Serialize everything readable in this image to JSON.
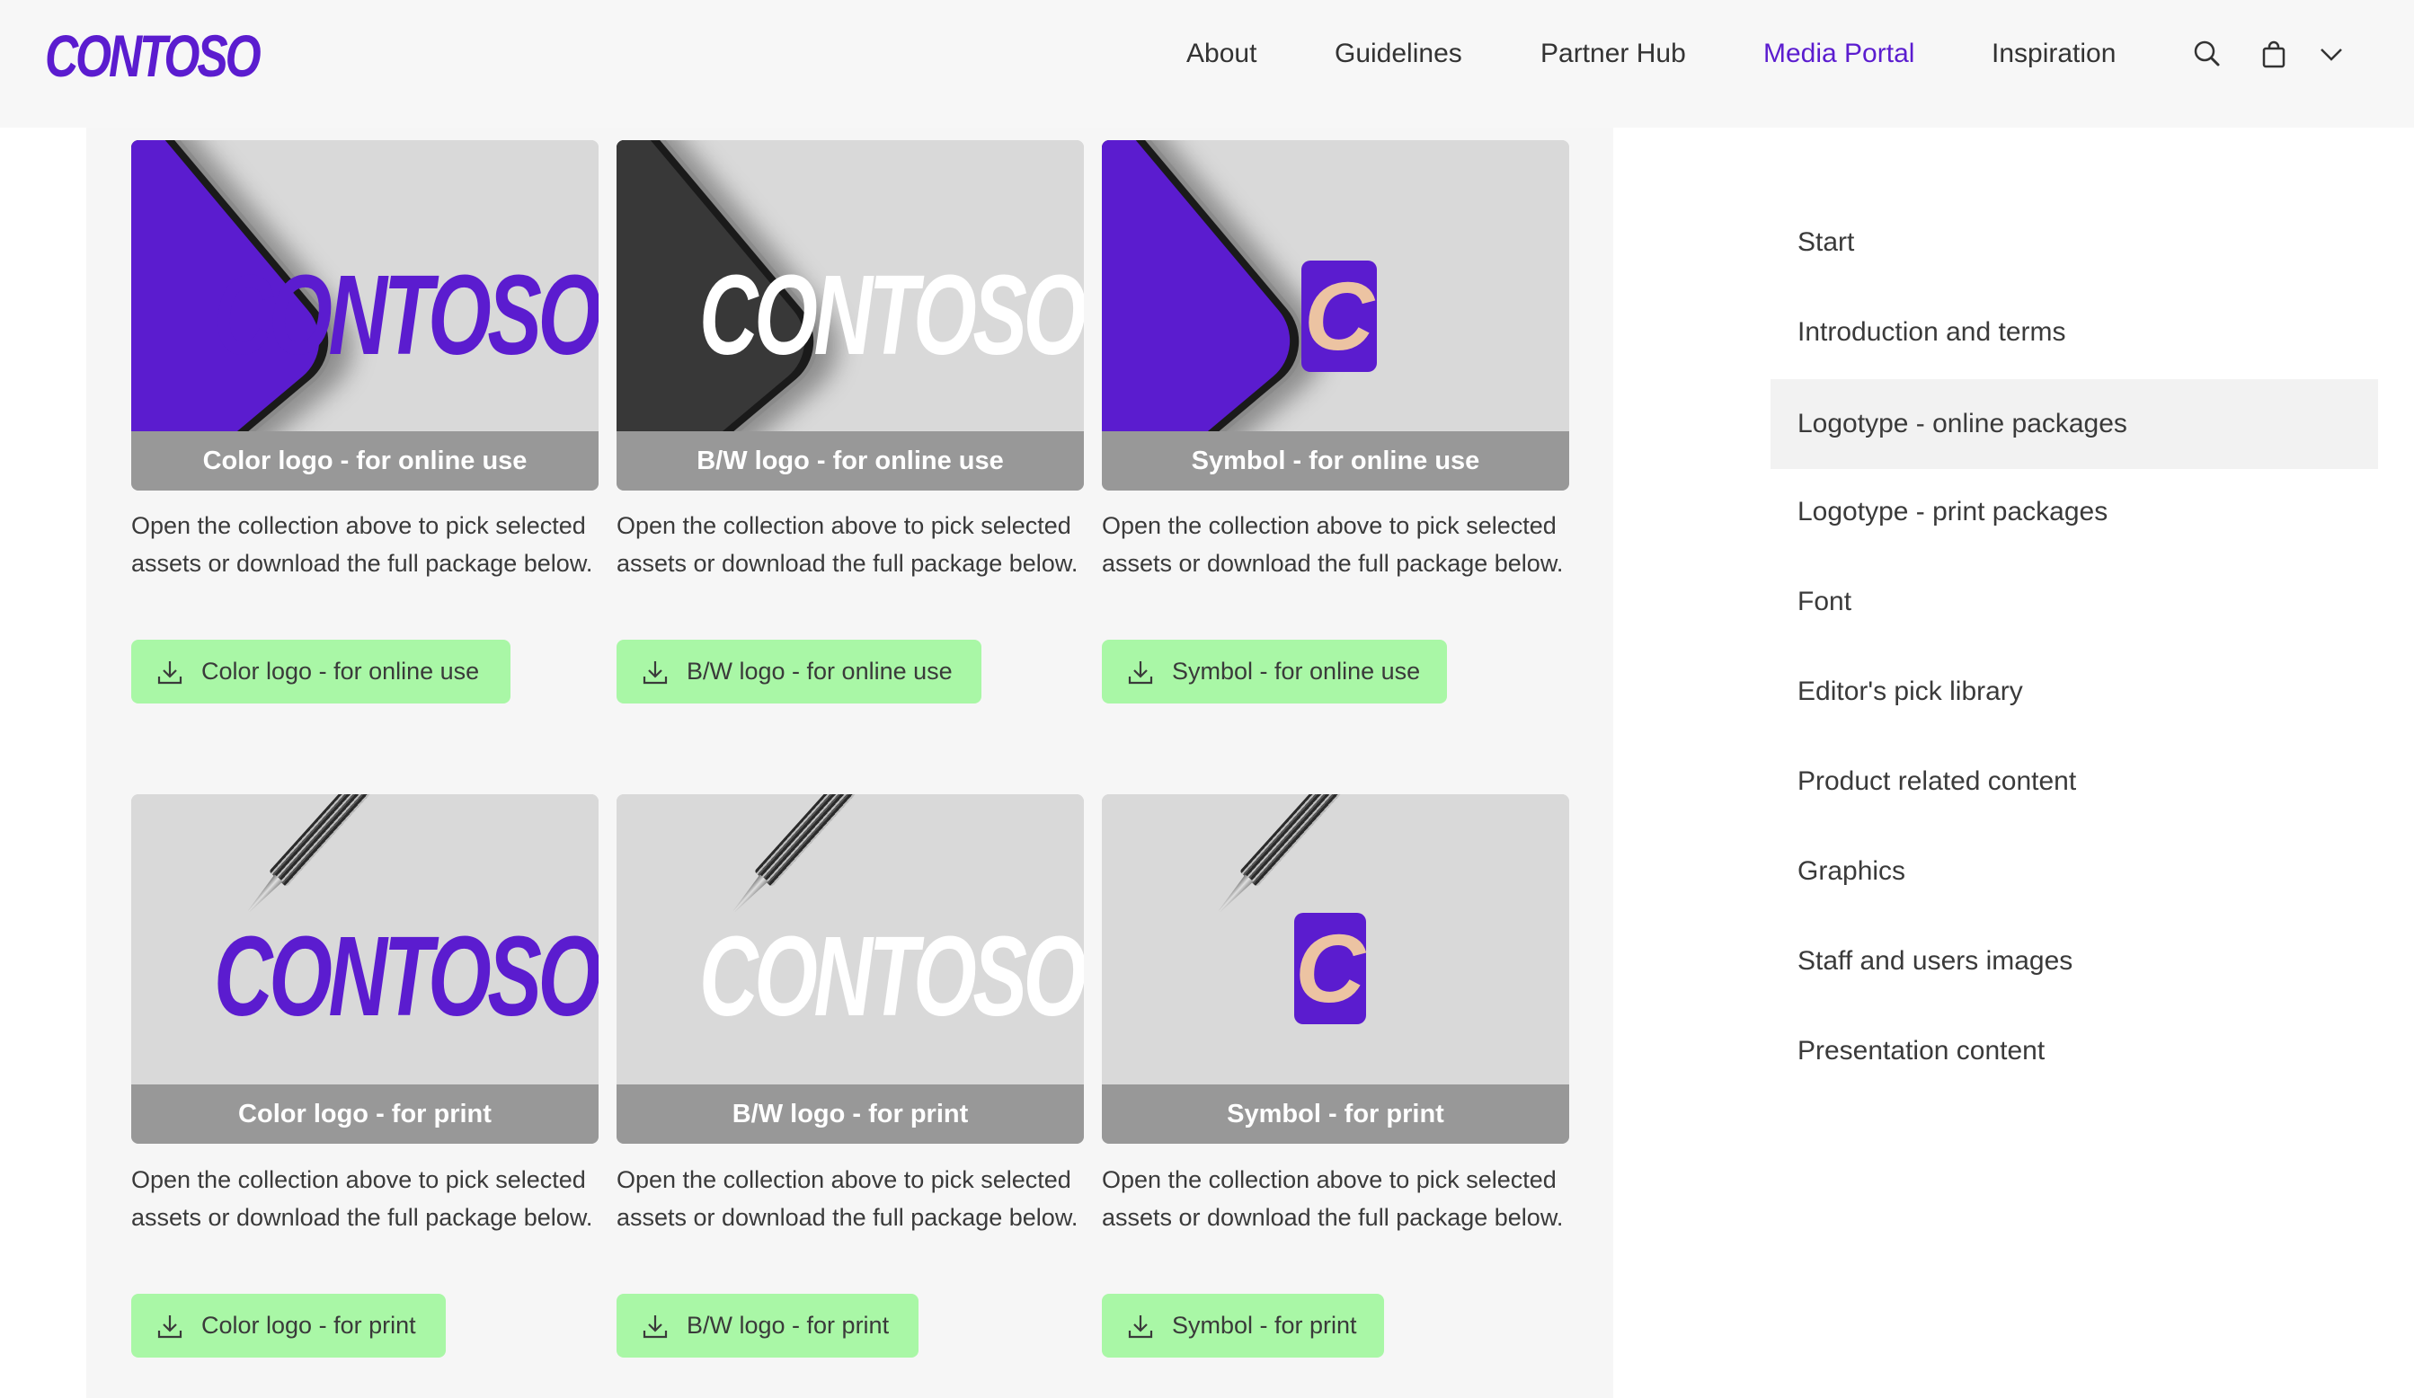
{
  "header": {
    "brand": "CONTOSO",
    "nav": [
      {
        "label": "About",
        "active": false
      },
      {
        "label": "Guidelines",
        "active": false
      },
      {
        "label": "Partner Hub",
        "active": false
      },
      {
        "label": "Media Portal",
        "active": true
      },
      {
        "label": "Inspiration",
        "active": false
      }
    ],
    "icons": [
      "search-icon",
      "shopping-bag-icon",
      "chevron-down-icon"
    ]
  },
  "colors": {
    "brand_purple": "#5b1ccf",
    "button_green": "#a9f7a6",
    "caption_gray": "#989898",
    "symbol_peach": "#ecc3a2"
  },
  "cards": [
    {
      "title": "Color logo - for online use",
      "description": "Open the collection above to pick selected assets or download the full package below.",
      "button": "Color logo - for online use",
      "image": {
        "prop": "phone",
        "phone_screen": "purple",
        "logo": "wordmark",
        "logo_style": "color",
        "wordmark": "CONTOSO"
      }
    },
    {
      "title": "B/W logo - for online use",
      "description": "Open the collection above to pick selected assets or download the full package below.",
      "button": "B/W logo - for online use",
      "image": {
        "prop": "phone",
        "phone_screen": "dark",
        "logo": "wordmark",
        "logo_style": "bw",
        "wordmark": "CONTOSO"
      }
    },
    {
      "title": "Symbol - for online use",
      "description": "Open the collection above to pick selected assets or download the full package below.",
      "button": "Symbol - for online use",
      "image": {
        "prop": "phone",
        "phone_screen": "purple",
        "logo": "symbol",
        "symbol": "C"
      }
    },
    {
      "title": "Color logo - for print",
      "description": "Open the collection above to pick selected assets or download the full package below.",
      "button": "Color logo - for print",
      "image": {
        "prop": "pen",
        "logo": "wordmark",
        "logo_style": "color",
        "wordmark": "CONTOSO"
      }
    },
    {
      "title": "B/W logo - for print",
      "description": "Open the collection above to pick selected assets or download the full package below.",
      "button": "B/W logo - for print",
      "image": {
        "prop": "pen",
        "logo": "wordmark",
        "logo_style": "bw",
        "wordmark": "CONTOSO"
      }
    },
    {
      "title": "Symbol - for print",
      "description": "Open the collection above to pick selected assets or download the full package below.",
      "button": "Symbol - for print",
      "image": {
        "prop": "pen",
        "logo": "symbol",
        "symbol": "C"
      }
    }
  ],
  "sidebar": {
    "items": [
      {
        "label": "Start",
        "active": false
      },
      {
        "label": "Introduction and terms",
        "active": false
      },
      {
        "label": "Logotype - online packages",
        "active": true
      },
      {
        "label": "Logotype - print packages",
        "active": false
      },
      {
        "label": "Font",
        "active": false
      },
      {
        "label": "Editor's pick library",
        "active": false
      },
      {
        "label": "Product related content",
        "active": false
      },
      {
        "label": "Graphics",
        "active": false
      },
      {
        "label": "Staff and users images",
        "active": false
      },
      {
        "label": "Presentation content",
        "active": false
      }
    ]
  }
}
